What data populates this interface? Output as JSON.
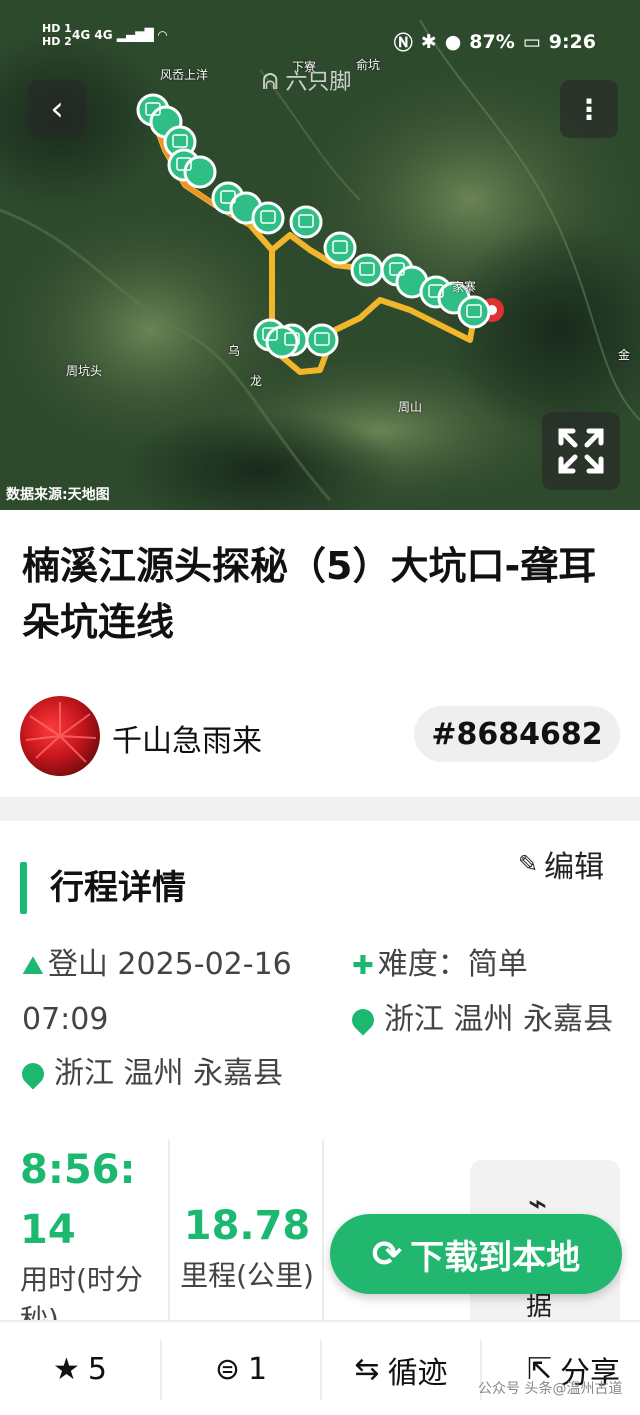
{
  "status_bar": {
    "hd1": "HD 1",
    "hd2": "HD 2",
    "signal": "4G 4G",
    "battery": "87%",
    "time": "9:26"
  },
  "map": {
    "watermark": "六只脚",
    "source": "数据来源:天地图",
    "places": [
      "风岙上洋",
      "下寮",
      "俞坑",
      "家寨",
      "周坑头",
      "周山",
      "乌",
      "龙",
      "金"
    ],
    "icons": {
      "back": "chevron-left-icon",
      "more": "more-vertical-icon",
      "expand": "expand-icon"
    }
  },
  "trip": {
    "title": "楠溪江源头探秘（5）大坑口-聋耳朵坑连线",
    "author": "千山急雨来",
    "track_id": "#8684682"
  },
  "section": {
    "title": "行程详情",
    "edit_label": "编辑"
  },
  "details": {
    "activity": "登山",
    "datetime": "2025-02-16 07:09",
    "start_location": "浙江 温州 永嘉县",
    "difficulty": "难度：简单",
    "end_location": "浙江 温州 永嘉县"
  },
  "stats": {
    "duration_value": "8:56:14",
    "duration_label": "用时(时分秒)",
    "distance_value": "18.78",
    "distance_label": "里程(公里)",
    "chart_label": "据"
  },
  "download": {
    "label": "下载到本地"
  },
  "bottom_bar": {
    "star_count": "5",
    "comment_count": "1",
    "follow_label": "循迹",
    "share_label": "分享"
  },
  "footer_watermark": "公众号 头条@温州古道",
  "colors": {
    "accent": "#1db870",
    "track": "#f2b62b",
    "marker": "#2fbf86"
  }
}
